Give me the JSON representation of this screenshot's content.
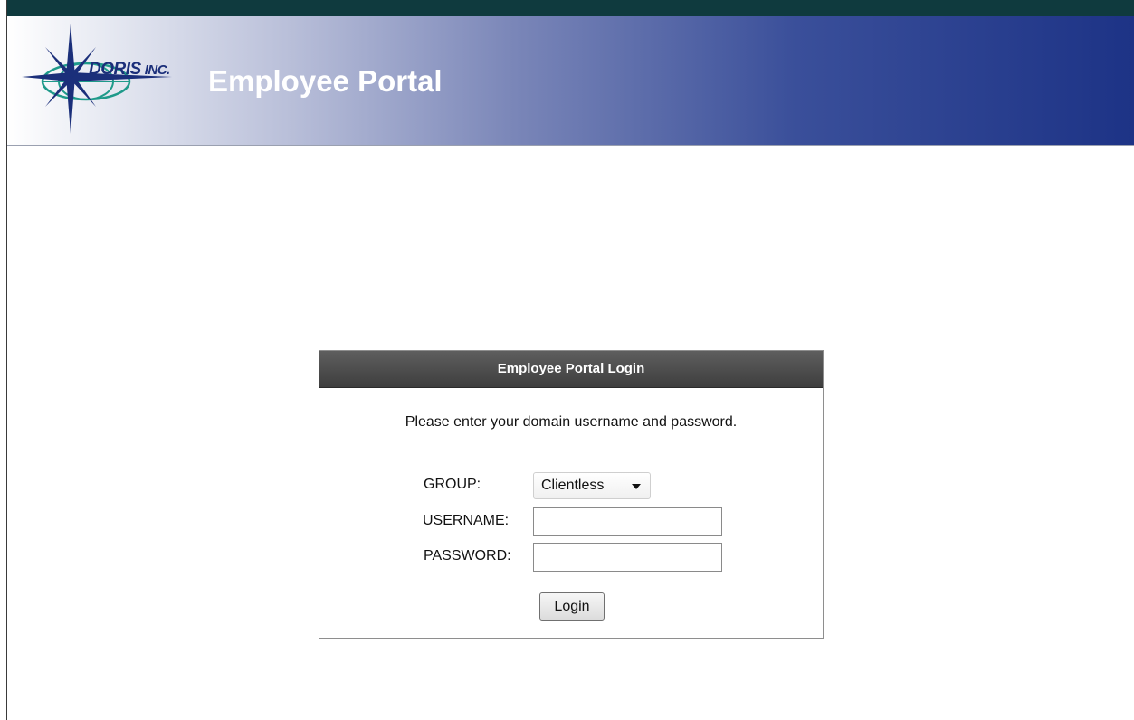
{
  "header": {
    "company_name": "DORIS",
    "company_suffix": "INC.",
    "title": "Employee Portal",
    "gradient_start": "#ffffff",
    "gradient_end": "#1d3386",
    "top_bar_color": "#0f3a3e"
  },
  "login": {
    "panel_title": "Employee Portal Login",
    "instructions": "Please enter your domain username and password.",
    "group_label": "GROUP:",
    "group_selected": "Clientless",
    "username_label": "USERNAME:",
    "username_value": "",
    "password_label": "PASSWORD:",
    "password_value": "",
    "login_button": "Login",
    "panel_header_color": "#4a4a4a"
  }
}
